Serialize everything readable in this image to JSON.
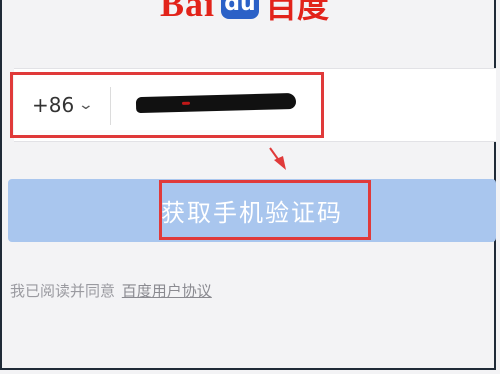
{
  "logo": {
    "latin_text": "Bai",
    "paw_text": "du",
    "chinese_text": "百度",
    "brand_red": "#e2231a",
    "brand_blue": "#2b61c7"
  },
  "phone": {
    "country_code": "+86",
    "number_redacted": true
  },
  "actions": {
    "get_code_label": "获取手机验证码",
    "button_color": "#a9c6ee"
  },
  "agreement": {
    "prefix": "我已阅读并同意",
    "link_text": "百度用户协议"
  },
  "annotations": {
    "highlight_color": "#e03a3a"
  }
}
